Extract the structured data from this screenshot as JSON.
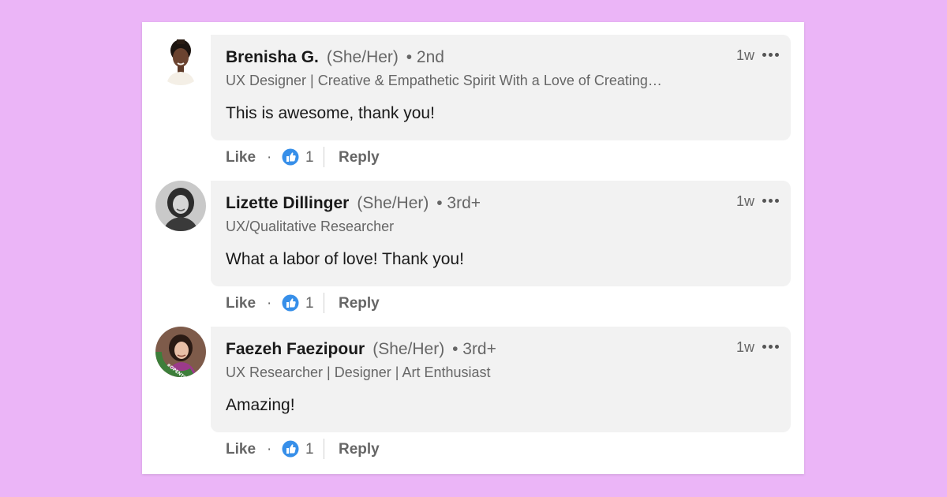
{
  "comments": [
    {
      "author": "Brenisha G.",
      "pronouns": "(She/Her)",
      "degree": "• 2nd",
      "headline": "UX Designer | Creative & Empathetic Spirit With a Love of Creating…",
      "text": "This is awesome, thank you!",
      "time": "1w",
      "like_label": "Like",
      "reaction_count": "1",
      "reply_label": "Reply"
    },
    {
      "author": "Lizette Dillinger",
      "pronouns": "(She/Her)",
      "degree": "• 3rd+",
      "headline": "UX/Qualitative Researcher",
      "text": "What a labor of love! Thank you!",
      "time": "1w",
      "like_label": "Like",
      "reaction_count": "1",
      "reply_label": "Reply"
    },
    {
      "author": "Faezeh Faezipour",
      "pronouns": "(She/Her)",
      "degree": "• 3rd+",
      "headline": "UX Researcher | Designer | Art Enthusiast",
      "text": "Amazing!",
      "time": "1w",
      "like_label": "Like",
      "reaction_count": "1",
      "reply_label": "Reply",
      "avatar_badge": "#OPENTOWORK"
    }
  ],
  "icons": {
    "more": "more-options-icon",
    "reaction": "like-reaction-icon"
  },
  "colors": {
    "background": "#ebb5f7",
    "bubble": "#f2f2f2",
    "reaction_blue": "#378fe9",
    "open_to_work_green": "#3d7e3a"
  }
}
